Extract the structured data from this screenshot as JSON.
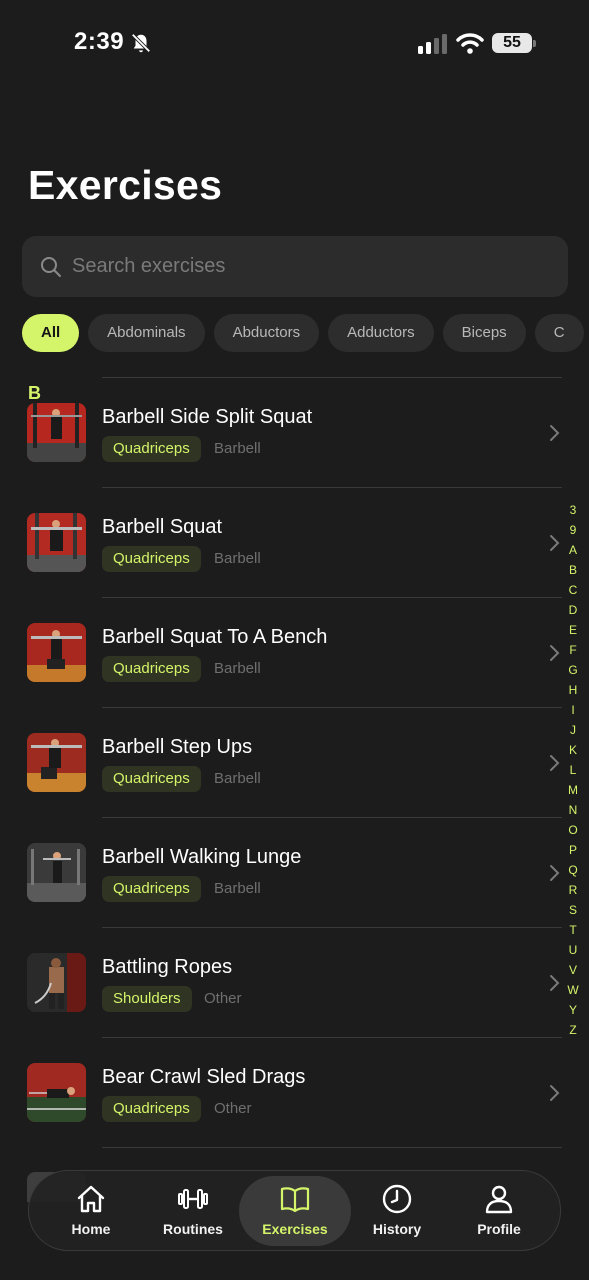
{
  "status": {
    "time": "2:39",
    "battery": "55"
  },
  "title": "Exercises",
  "search": {
    "placeholder": "Search exercises"
  },
  "chips": [
    "All",
    "Abdominals",
    "Abductors",
    "Adductors",
    "Biceps",
    "C"
  ],
  "section_letter": "B",
  "exercises": [
    {
      "name": "Barbell Side Split Squat",
      "muscle": "Quadriceps",
      "equipment": "Barbell"
    },
    {
      "name": "Barbell Squat",
      "muscle": "Quadriceps",
      "equipment": "Barbell"
    },
    {
      "name": "Barbell Squat To A Bench",
      "muscle": "Quadriceps",
      "equipment": "Barbell"
    },
    {
      "name": "Barbell Step Ups",
      "muscle": "Quadriceps",
      "equipment": "Barbell"
    },
    {
      "name": "Barbell Walking Lunge",
      "muscle": "Quadriceps",
      "equipment": "Barbell"
    },
    {
      "name": "Battling Ropes",
      "muscle": "Shoulders",
      "equipment": "Other"
    },
    {
      "name": "Bear Crawl Sled Drags",
      "muscle": "Quadriceps",
      "equipment": "Other"
    }
  ],
  "alpha_index": [
    "3",
    "9",
    "A",
    "B",
    "C",
    "D",
    "E",
    "F",
    "G",
    "H",
    "I",
    "J",
    "K",
    "L",
    "M",
    "N",
    "O",
    "P",
    "Q",
    "R",
    "S",
    "T",
    "U",
    "V",
    "W",
    "Y",
    "Z"
  ],
  "tabs": [
    {
      "label": "Home",
      "icon": "home-icon"
    },
    {
      "label": "Routines",
      "icon": "dumbbell-icon"
    },
    {
      "label": "Exercises",
      "icon": "book-icon"
    },
    {
      "label": "History",
      "icon": "clock-icon"
    },
    {
      "label": "Profile",
      "icon": "person-icon"
    }
  ],
  "colors": {
    "accent": "#d4f46a",
    "background": "#1c1c1c",
    "tag_bg": "#2f3522"
  }
}
